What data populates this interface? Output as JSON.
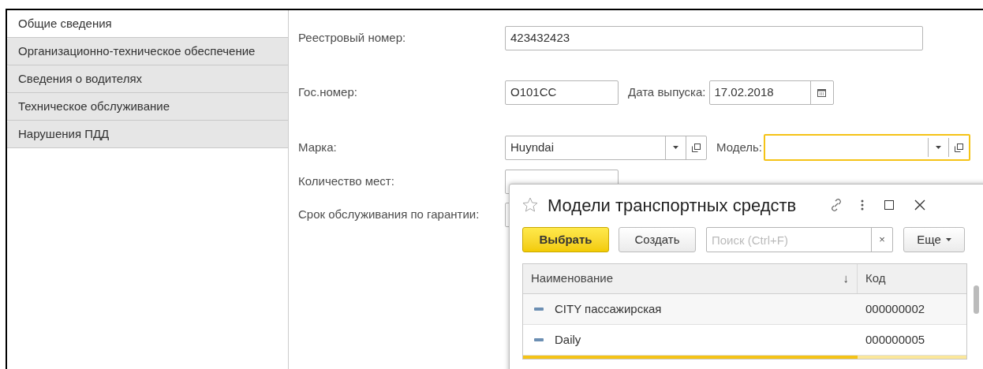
{
  "tabs": [
    {
      "label": "Общие сведения",
      "selected": true
    },
    {
      "label": "Организационно-техническое обеспечение",
      "selected": false
    },
    {
      "label": "Сведения о водителях",
      "selected": false
    },
    {
      "label": "Техническое обслуживание",
      "selected": false
    },
    {
      "label": "Нарушения ПДД",
      "selected": false
    }
  ],
  "form": {
    "registry_number": {
      "label": "Реестровый номер:",
      "value": "423432423"
    },
    "plate": {
      "label": "Гос.номер:",
      "value": "О101СС"
    },
    "release_date": {
      "label": "Дата выпуска:",
      "value": "17.02.2018"
    },
    "brand": {
      "label": "Марка:",
      "value": "Huyndai"
    },
    "model": {
      "label": "Модель:",
      "focused": true
    },
    "seats": {
      "label": "Количество мест:"
    },
    "warranty": {
      "label": "Срок обслуживания по гарантии:"
    }
  },
  "popup": {
    "title": "Модели транспортных средств",
    "select_button": "Выбрать",
    "create_button": "Создать",
    "search": {
      "placeholder": "Поиск (Ctrl+F)"
    },
    "clear": "×",
    "more_button": "Еще",
    "table": {
      "columns": [
        {
          "label": "Наименование",
          "sort": "↓"
        },
        {
          "label": "Код"
        }
      ],
      "rows": [
        {
          "name": "CITY пассажирская",
          "code": "000000002",
          "selected": false
        },
        {
          "name": "Daily",
          "code": "000000005",
          "selected": false
        }
      ]
    }
  }
}
